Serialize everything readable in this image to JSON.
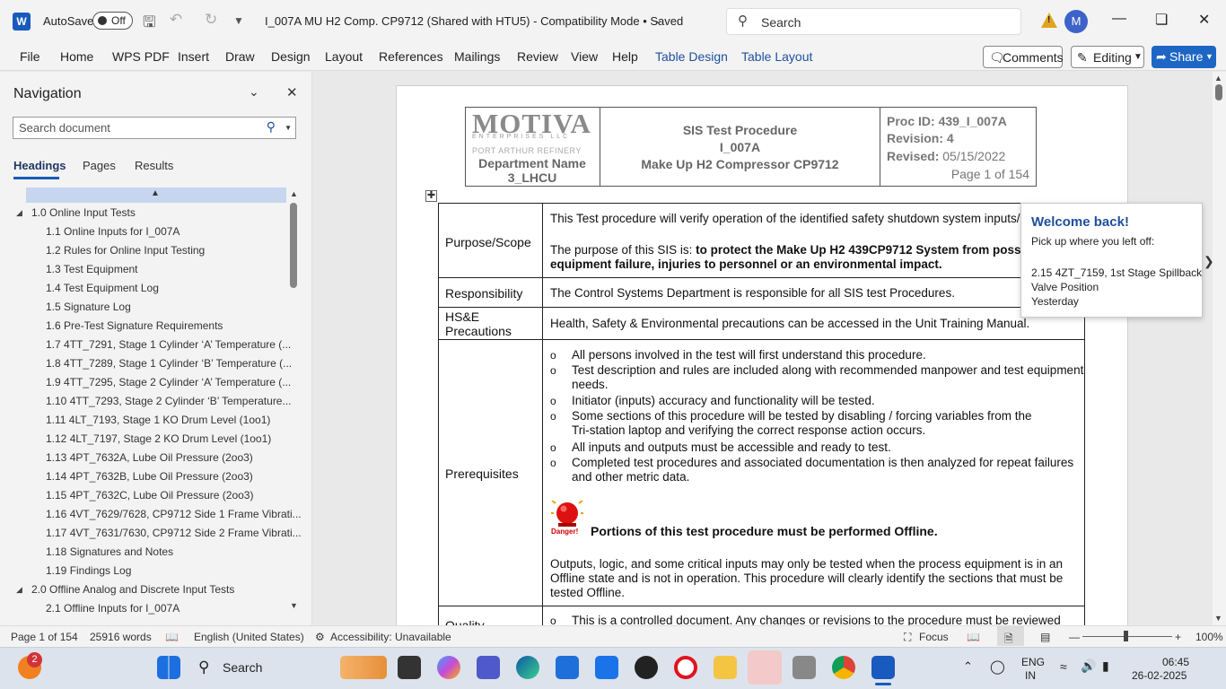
{
  "titlebar": {
    "app_icon": "W",
    "autosave_label": "AutoSave",
    "autosave_state": "Off",
    "document_title": "I_007A MU H2 Comp. CP9712 (Shared with HTU5)  -  Compatibility Mode  •  Saved",
    "search_placeholder": "Search",
    "avatar_initial": "M"
  },
  "menu": {
    "items": [
      "File",
      "Home",
      "WPS PDF",
      "Insert",
      "Draw",
      "Design",
      "Layout",
      "References",
      "Mailings",
      "Review",
      "View",
      "Help",
      "Table Design",
      "Table Layout"
    ],
    "comments_label": "Comments",
    "editing_label": "Editing",
    "share_label": "Share"
  },
  "navigation": {
    "title": "Navigation",
    "search_placeholder": "Search document",
    "tabs": [
      "Headings",
      "Pages",
      "Results"
    ],
    "active_tab": "Headings",
    "headings": [
      {
        "level": 1,
        "text": "1.0 Online Input Tests"
      },
      {
        "level": 2,
        "text": "1.1 Online Inputs for I_007A"
      },
      {
        "level": 2,
        "text": "1.2 Rules for Online Input Testing"
      },
      {
        "level": 2,
        "text": "1.3 Test Equipment"
      },
      {
        "level": 2,
        "text": "1.4 Test Equipment Log"
      },
      {
        "level": 2,
        "text": "1.5 Signature Log"
      },
      {
        "level": 2,
        "text": "1.6 Pre-Test Signature Requirements"
      },
      {
        "level": 2,
        "text": "1.7 4TT_7291, Stage 1 Cylinder ‘A’ Temperature (..."
      },
      {
        "level": 2,
        "text": "1.8 4TT_7289, Stage 1 Cylinder ‘B’ Temperature (..."
      },
      {
        "level": 2,
        "text": "1.9 4TT_7295, Stage 2 Cylinder ‘A’ Temperature (..."
      },
      {
        "level": 2,
        "text": "1.10 4TT_7293, Stage 2 Cylinder ‘B’ Temperature..."
      },
      {
        "level": 2,
        "text": "1.11 4LT_7193, Stage 1 KO Drum Level (1oo1)"
      },
      {
        "level": 2,
        "text": "1.12 4LT_7197, Stage 2 KO Drum Level (1oo1)"
      },
      {
        "level": 2,
        "text": "1.13 4PT_7632A, Lube Oil Pressure (2oo3)"
      },
      {
        "level": 2,
        "text": "1.14 4PT_7632B, Lube Oil Pressure (2oo3)"
      },
      {
        "level": 2,
        "text": "1.15 4PT_7632C, Lube Oil Pressure (2oo3)"
      },
      {
        "level": 2,
        "text": "1.16 4VT_7629/7628, CP9712 Side 1 Frame Vibrati..."
      },
      {
        "level": 2,
        "text": "1.17 4VT_7631/7630, CP9712 Side 2 Frame Vibrati..."
      },
      {
        "level": 2,
        "text": "1.18 Signatures and Notes"
      },
      {
        "level": 2,
        "text": "1.19 Findings Log"
      },
      {
        "level": 1,
        "text": "2.0 Offline Analog and Discrete Input Tests"
      },
      {
        "level": 2,
        "text": "2.1 Offline Inputs for I_007A"
      }
    ]
  },
  "doc_header": {
    "logo_text": "MOTIVA",
    "logo_sub": "ENTERPRISES LLC",
    "refinery": "PORT ARTHUR REFINERY",
    "dept_name": "Department Name",
    "dept_code": "3_LHCU",
    "title_line1": "SIS Test Procedure",
    "title_line2": "I_007A",
    "title_line3": "Make Up H2 Compressor CP9712",
    "proc_id": "Proc ID: 439_I_007A",
    "revision": "Revision: 4",
    "revised_label": "Revised:",
    "revised_date": " 05/15/2022",
    "page_of": "Page 1 of 154"
  },
  "doc_table": {
    "purpose_label": "Purpose/Scope",
    "purpose_line1": "This Test procedure will verify operation of the identified safety shutdown system inputs/o",
    "purpose_line2_pre": "The purpose of this SIS is:  ",
    "purpose_line2_bold": "to protect the Make Up H2 439CP9712 System from poss",
    "purpose_line3_bold": "equipment failure, injuries to personnel or an environmental impact.",
    "responsibility_label": "Responsibility",
    "responsibility_text": "The Control Systems Department is responsible for all SIS test Procedures.",
    "hse_label_1": "HS&E",
    "hse_label_2": "Precautions",
    "hse_text": "Health, Safety & Environmental precautions can be accessed in the Unit Training Manual.",
    "prereq_label": "Prerequisites",
    "bullet_symbol": "o",
    "prereq_bullets": [
      [
        "All persons involved in the test will first understand this procedure."
      ],
      [
        "Test description and rules are included along with recommended manpower and test equipment",
        "needs."
      ],
      [
        "Initiator (inputs) accuracy and functionality will be tested."
      ],
      [
        "Some sections of this procedure will be tested by disabling / forcing variables from the",
        "Tri-station laptop and verifying the correct response action occurs."
      ],
      [
        "All inputs and outputs must be accessible and ready to test."
      ],
      [
        "Completed test procedures and associated documentation is then analyzed for repeat failures",
        "and other metric data."
      ]
    ],
    "danger_caption": "Danger!",
    "offline_warning": "Portions of this test procedure must be performed Offline.",
    "offline_para": [
      "Outputs, logic, and some critical inputs may only be tested when the process equipment is in an",
      "Offline state and is not in operation.  This procedure will clearly identify the sections that must be",
      "tested Offline."
    ],
    "quality_label_partial": "Quality",
    "quality_bullet": "This is a controlled document.  Any changes or revisions to the procedure must be reviewed"
  },
  "popup": {
    "title": "Welcome back!",
    "subtitle": "Pick up where you left off:",
    "section_line1": "2.15 4ZT_7159, 1st Stage Spillback",
    "section_line2": "Valve Position",
    "when": "Yesterday"
  },
  "statusbar": {
    "page": "Page 1 of 154",
    "words": "25916 words",
    "language": "English (United States)",
    "accessibility": "Accessibility: Unavailable",
    "focus": "Focus",
    "zoom": "100%",
    "zoom_level_percent": 100
  },
  "taskbar": {
    "search_label": "Search",
    "badge_count": "2",
    "lang_line1": "ENG",
    "lang_line2": "IN",
    "time": "06:45",
    "date": "26-02-2025",
    "app_icons": [
      "widgets-icon",
      "start-icon",
      "search-icon",
      "paint-icon",
      "terminal-icon",
      "copilot-icon",
      "teams-icon",
      "edge-icon",
      "store-icon",
      "mail-icon",
      "dell-icon",
      "opera-icon",
      "file-explorer-icon",
      "photos-icon",
      "media-icon",
      "chrome-icon",
      "word-icon"
    ]
  },
  "colors": {
    "accent": "#185abd",
    "share": "#1e66c4",
    "popup_title": "#1f4f9e",
    "warn": "#e0a422"
  }
}
